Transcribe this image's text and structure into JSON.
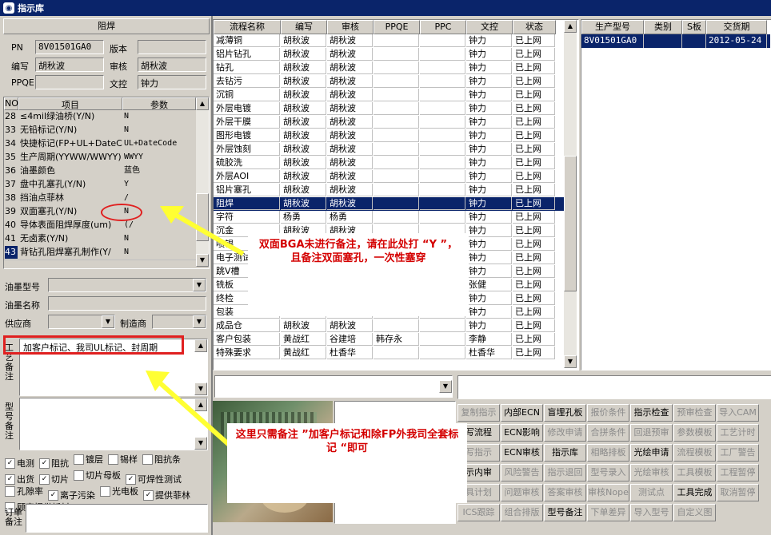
{
  "window": {
    "title": "指示库"
  },
  "left": {
    "section_title": "阻焊",
    "pn_label": "PN",
    "pn_value": "8V01501GA0",
    "version_label": "版本",
    "version_value": "",
    "writer_label": "编写",
    "writer_value": "胡秋波",
    "review_label": "审核",
    "review_value": "胡秋波",
    "ppqe_label": "PPQE",
    "ppqe_value": "",
    "doc_label": "文控",
    "doc_value": "钟力",
    "params_headers": {
      "no": "NO",
      "item": "项目",
      "param": "参数"
    },
    "params": [
      {
        "no": "28",
        "item": "≤4mil绿油桥(Y/N)",
        "param": "N"
      },
      {
        "no": "33",
        "item": "无铅标记(Y/N)",
        "param": "N"
      },
      {
        "no": "34",
        "item": "快捷标记(FP+UL+DateCo",
        "param": "UL+DateCode"
      },
      {
        "no": "35",
        "item": "生产周期(YYWW/WWYY)",
        "param": "WWYY"
      },
      {
        "no": "36",
        "item": "油墨颜色",
        "param": "蓝色"
      },
      {
        "no": "37",
        "item": "盘中孔塞孔(Y/N)",
        "param": "Y"
      },
      {
        "no": "38",
        "item": "挡油点菲林",
        "param": "/"
      },
      {
        "no": "39",
        "item": "双面塞孔(Y/N)",
        "param": "N"
      },
      {
        "no": "40",
        "item": "导体表面阻焊厚度(um)",
        "param": "(/"
      },
      {
        "no": "41",
        "item": "无卤素(Y/N)",
        "param": "N"
      },
      {
        "no": "43",
        "item": "背钻孔阻焊塞孔制作(Y/",
        "param": "N"
      }
    ],
    "ink_model_label": "油墨型号",
    "ink_name_label": "油墨名称",
    "supplier_label": "供应商",
    "maker_label": "制造商",
    "process_note_label": "工艺备注",
    "process_note_value": "加客户标记、我司UL标记、封周期",
    "model_note_label": "型号备注",
    "order_note_label": "订单备注",
    "checkboxes": [
      {
        "label": "电测",
        "checked": true
      },
      {
        "label": "阻抗",
        "checked": true
      },
      {
        "label": "镀层",
        "checked": false
      },
      {
        "label": "锡样",
        "checked": false
      },
      {
        "label": "阻抗条",
        "checked": false
      },
      {
        "label": "出货",
        "checked": true
      },
      {
        "label": "切片",
        "checked": true
      },
      {
        "label": "切片母板",
        "checked": false
      },
      {
        "label": "可焊性测试",
        "checked": true
      },
      {
        "label": "孔隙率",
        "checked": false
      },
      {
        "label": "离子污染",
        "checked": true
      },
      {
        "label": "光电板",
        "checked": false
      },
      {
        "label": "提供菲林",
        "checked": true
      },
      {
        "label": "顾客提供板材",
        "checked": false
      }
    ]
  },
  "flow": {
    "headers": [
      "流程名称",
      "编写",
      "审核",
      "PPQE",
      "PPC",
      "文控",
      "状态"
    ],
    "rows": [
      [
        "减薄铜",
        "胡秋波",
        "胡秋波",
        "",
        "",
        "钟力",
        "已上网"
      ],
      [
        "铝片钻孔",
        "胡秋波",
        "胡秋波",
        "",
        "",
        "钟力",
        "已上网"
      ],
      [
        "钻孔",
        "胡秋波",
        "胡秋波",
        "",
        "",
        "钟力",
        "已上网"
      ],
      [
        "去钻污",
        "胡秋波",
        "胡秋波",
        "",
        "",
        "钟力",
        "已上网"
      ],
      [
        "沉铜",
        "胡秋波",
        "胡秋波",
        "",
        "",
        "钟力",
        "已上网"
      ],
      [
        "外层电镀",
        "胡秋波",
        "胡秋波",
        "",
        "",
        "钟力",
        "已上网"
      ],
      [
        "外层干膜",
        "胡秋波",
        "胡秋波",
        "",
        "",
        "钟力",
        "已上网"
      ],
      [
        "图形电镀",
        "胡秋波",
        "胡秋波",
        "",
        "",
        "钟力",
        "已上网"
      ],
      [
        "外层蚀刻",
        "胡秋波",
        "胡秋波",
        "",
        "",
        "钟力",
        "已上网"
      ],
      [
        "硫胶洗",
        "胡秋波",
        "胡秋波",
        "",
        "",
        "钟力",
        "已上网"
      ],
      [
        "外层AOI",
        "胡秋波",
        "胡秋波",
        "",
        "",
        "钟力",
        "已上网"
      ],
      [
        "铝片塞孔",
        "胡秋波",
        "胡秋波",
        "",
        "",
        "钟力",
        "已上网"
      ],
      [
        "阻焊",
        "胡秋波",
        "胡秋波",
        "",
        "",
        "钟力",
        "已上网"
      ],
      [
        "字符",
        "杨勇",
        "杨勇",
        "",
        "",
        "钟力",
        "已上网"
      ],
      [
        "沉金",
        "胡秋波",
        "胡秋波",
        "",
        "",
        "钟力",
        "已上网"
      ],
      [
        "喷锡",
        "胡秋波",
        "胡秋波",
        "",
        "",
        "钟力",
        "已上网"
      ],
      [
        "电子测试",
        "胡秋波",
        "胡秋波",
        "",
        "",
        "钟力",
        "已上网"
      ],
      [
        "跳V槽",
        "胡秋波",
        "胡秋波",
        "",
        "",
        "钟力",
        "已上网"
      ],
      [
        "铣板",
        "胡秋波",
        "胡秋波",
        "",
        "",
        "张健",
        "已上网"
      ],
      [
        "终检",
        "胡秋波",
        "胡秋波",
        "",
        "",
        "钟力",
        "已上网"
      ],
      [
        "包装",
        "胡秋波",
        "胡秋波",
        "",
        "",
        "钟力",
        "已上网"
      ],
      [
        "成品仓",
        "胡秋波",
        "胡秋波",
        "",
        "",
        "钟力",
        "已上网"
      ],
      [
        "客户包装",
        "黄战红",
        "谷建培",
        "韩存永",
        "",
        "李静",
        "已上网"
      ],
      [
        "特殊要求",
        "黄战红",
        "杜香华",
        "",
        "",
        "杜香华",
        "已上网"
      ]
    ],
    "selected_row": 12
  },
  "product": {
    "headers": [
      "生产型号",
      "类别",
      "S板",
      "交货期"
    ],
    "rows": [
      [
        "8V01501GA0",
        "",
        "",
        "2012-05-24"
      ]
    ]
  },
  "toolbar_buttons": [
    {
      "label": "复制指示",
      "enabled": false
    },
    {
      "label": "内部ECN",
      "enabled": true
    },
    {
      "label": "盲埋孔板",
      "enabled": true
    },
    {
      "label": "报价条件",
      "enabled": false
    },
    {
      "label": "指示检查",
      "enabled": true
    },
    {
      "label": "预审检查",
      "enabled": false
    },
    {
      "label": "导入CAM",
      "enabled": false
    },
    {
      "label": "写流程",
      "enabled": true
    },
    {
      "label": "ECN影响",
      "enabled": true
    },
    {
      "label": "修改申请",
      "enabled": false
    },
    {
      "label": "合拼条件",
      "enabled": false
    },
    {
      "label": "回退预审",
      "enabled": false
    },
    {
      "label": "参数模板",
      "enabled": false
    },
    {
      "label": "工艺计时",
      "enabled": false
    },
    {
      "label": "写指示",
      "enabled": false
    },
    {
      "label": "ECN审核",
      "enabled": true
    },
    {
      "label": "指示库",
      "enabled": true
    },
    {
      "label": "相略排板",
      "enabled": false
    },
    {
      "label": "光绘申请",
      "enabled": true
    },
    {
      "label": "流程模板",
      "enabled": false
    },
    {
      "label": "工厂警告",
      "enabled": false
    },
    {
      "label": "示内审",
      "enabled": true
    },
    {
      "label": "风险警告",
      "enabled": false
    },
    {
      "label": "指示退回",
      "enabled": false
    },
    {
      "label": "型号录入",
      "enabled": false
    },
    {
      "label": "光绘审核",
      "enabled": false
    },
    {
      "label": "工具模板",
      "enabled": false
    },
    {
      "label": "工程暂停",
      "enabled": false
    },
    {
      "label": "具计划",
      "enabled": false
    },
    {
      "label": "问题审核",
      "enabled": false
    },
    {
      "label": "答案审核",
      "enabled": false
    },
    {
      "label": "审核Nope",
      "enabled": false
    },
    {
      "label": "测试点",
      "enabled": false
    },
    {
      "label": "工具完成",
      "enabled": true
    },
    {
      "label": "取消暂停",
      "enabled": false
    },
    {
      "label": "ICS跟踪",
      "enabled": false
    },
    {
      "label": "组合排版",
      "enabled": false
    },
    {
      "label": "型号备注",
      "enabled": true
    },
    {
      "label": "下单差异",
      "enabled": false
    },
    {
      "label": "导入型号",
      "enabled": false
    },
    {
      "label": "自定义图",
      "enabled": false
    }
  ],
  "annotations": {
    "note1": "双面BGA未进行备注，请在此处打 “Y ”，且备注双面塞孔，一次性塞穿",
    "note2": "这里只需备注 ”加客户标记和除FP外我司全套标记 “即可",
    "highlight_color": "#e02020",
    "arrow_color": "#ffff33"
  }
}
